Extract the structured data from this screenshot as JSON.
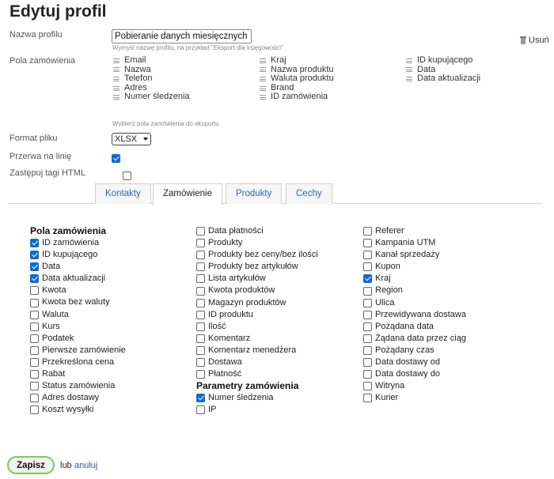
{
  "page_title": "Edytuj profil",
  "profile_name": {
    "label": "Nazwa profilu",
    "value": "Pobieranie danych miesięcznych",
    "hint": "Wymyśl nazwę profilu, na przykład \"Eksport dla księgowości\""
  },
  "delete_label": "Usuń",
  "order_fields": {
    "label": "Pola zamówienia",
    "columns": [
      [
        "Email",
        "Nazwa",
        "Telefon",
        "Adres",
        "Numer śledzenia"
      ],
      [
        "Kraj",
        "Nazwa produktu",
        "Waluta produktu",
        "Brand",
        "ID zamówienia"
      ],
      [
        "ID kupującego",
        "Data",
        "Data aktualizacji"
      ]
    ],
    "hint": "Wybierz pola zamówienia do eksportu"
  },
  "file_format": {
    "label": "Format pliku",
    "value": "XLSX"
  },
  "line_break": {
    "label": "Przerwa na linię",
    "checked": true
  },
  "replace_html": {
    "label": "Zastępuj tagi HTML",
    "checked": false
  },
  "tabs": [
    {
      "label": "Kontakty",
      "active": false
    },
    {
      "label": "Zamówienie",
      "active": true
    },
    {
      "label": "Produkty",
      "active": false
    },
    {
      "label": "Cechy",
      "active": false
    }
  ],
  "order_options": {
    "col1": {
      "heading": "Pola zamówienia",
      "items": [
        {
          "label": "ID zamówienia",
          "checked": true
        },
        {
          "label": "ID kupującego",
          "checked": true
        },
        {
          "label": "Data",
          "checked": true
        },
        {
          "label": "Data aktualizacji",
          "checked": true
        },
        {
          "label": "Kwota",
          "checked": false
        },
        {
          "label": "Kwota bez waluty",
          "checked": false
        },
        {
          "label": "Waluta",
          "checked": false
        },
        {
          "label": "Kurs",
          "checked": false
        },
        {
          "label": "Podatek",
          "checked": false
        },
        {
          "label": "Pierwsze zamówienie",
          "checked": false
        },
        {
          "label": "Przekreślona cena",
          "checked": false
        },
        {
          "label": "Rabat",
          "checked": false
        },
        {
          "label": "Status zamówienia",
          "checked": false
        },
        {
          "label": "Adres dostawy",
          "checked": false
        },
        {
          "label": "Koszt wysyłki",
          "checked": false
        }
      ]
    },
    "col2": {
      "items": [
        {
          "label": "Data płatności",
          "checked": false
        },
        {
          "label": "Produkty",
          "checked": false
        },
        {
          "label": "Produkty bez ceny/bez ilości",
          "checked": false
        },
        {
          "label": "Produkty bez artykułów",
          "checked": false
        },
        {
          "label": "Lista artykułów",
          "checked": false
        },
        {
          "label": "Kwota produktów",
          "checked": false
        },
        {
          "label": "Magazyn produktów",
          "checked": false
        },
        {
          "label": "ID produktu",
          "checked": false
        },
        {
          "label": "Ilość",
          "checked": false
        },
        {
          "label": "Komentarz",
          "checked": false
        },
        {
          "label": "Komentarz menedżera",
          "checked": false
        },
        {
          "label": "Dostawa",
          "checked": false
        },
        {
          "label": "Płatność",
          "checked": false
        }
      ],
      "heading2": "Parametry zamówienia",
      "items2": [
        {
          "label": "Numer śledzenia",
          "checked": true
        },
        {
          "label": "IP",
          "checked": false
        }
      ]
    },
    "col3": {
      "items": [
        {
          "label": "Referer",
          "checked": false
        },
        {
          "label": "Kampania UTM",
          "checked": false
        },
        {
          "label": "Kanał sprzedaży",
          "checked": false
        },
        {
          "label": "Kupon",
          "checked": false
        },
        {
          "label": "Kraj",
          "checked": true
        },
        {
          "label": "Region",
          "checked": false
        },
        {
          "label": "Ulica",
          "checked": false
        },
        {
          "label": "Przewidywana dostawa",
          "checked": false
        },
        {
          "label": "Pożądana data",
          "checked": false
        },
        {
          "label": "Żądana data przez ciąg",
          "checked": false
        },
        {
          "label": "Pożądany czas",
          "checked": false
        },
        {
          "label": "Data dostawy od",
          "checked": false
        },
        {
          "label": "Data dostawy do",
          "checked": false
        },
        {
          "label": "Witryna",
          "checked": false
        },
        {
          "label": "Kurier",
          "checked": false
        }
      ]
    }
  },
  "actions": {
    "save": "Zapisz",
    "or": "lub",
    "cancel": "anuluj"
  }
}
